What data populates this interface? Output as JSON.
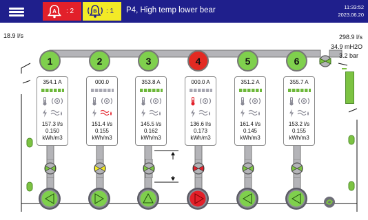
{
  "header": {
    "menu_icon": "hamburger-menu-icon",
    "alarm_icon": "alarm-bell-icon",
    "alarm_count": ": 2",
    "warning_icon": "warning-bell-icon",
    "warning_count": ": 1",
    "title": "P4, High temp lower bear",
    "time": "11:33:52",
    "date": "2023.06.20",
    "colors": {
      "bar": "#1f1f8c",
      "alarm": "#e2202a",
      "warning": "#f3ea26"
    }
  },
  "plant": {
    "inflow": "18.9 l/s",
    "outflow": "298.9 l/s",
    "pressure_head": "34.9 mH2O",
    "pressure": "3.2 bar"
  },
  "pumps": [
    {
      "number": "1",
      "current": "354.1 A",
      "flow": "157.3 l/s",
      "energy": "0.150",
      "unit": "kWh/m3",
      "status": "running",
      "direction": "left",
      "valve": "green"
    },
    {
      "number": "2",
      "current": "000.0",
      "flow": "151.4 l/s",
      "energy": "0.155",
      "unit": "kWh/m3",
      "status": "stopped",
      "direction": "right",
      "valve": "yellow"
    },
    {
      "number": "3",
      "current": "353.8 A",
      "flow": "145.5 l/s",
      "energy": "0.162",
      "unit": "kWh/m3",
      "status": "running",
      "direction": "up",
      "valve": "green"
    },
    {
      "number": "4",
      "current": "000.0 A",
      "flow": "136.6 l/s",
      "energy": "0.173",
      "unit": "kWh/m3",
      "status": "alarm",
      "direction": "right",
      "valve": "red"
    },
    {
      "number": "5",
      "current": "351.2 A",
      "flow": "161.4 l/s",
      "energy": "0.145",
      "unit": "kWh/m3",
      "status": "running",
      "direction": "left",
      "valve": "green"
    },
    {
      "number": "6",
      "current": "355.7 A",
      "flow": "153.2 l/s",
      "energy": "0.155",
      "unit": "kWh/m3",
      "status": "running",
      "direction": "left",
      "valve": "green"
    }
  ],
  "status_colors": {
    "running": "#7fd04d",
    "alarm": "#e32a22",
    "valve_green": "#7cc342",
    "valve_yellow": "#f3ea26",
    "valve_red": "#e2202a"
  }
}
